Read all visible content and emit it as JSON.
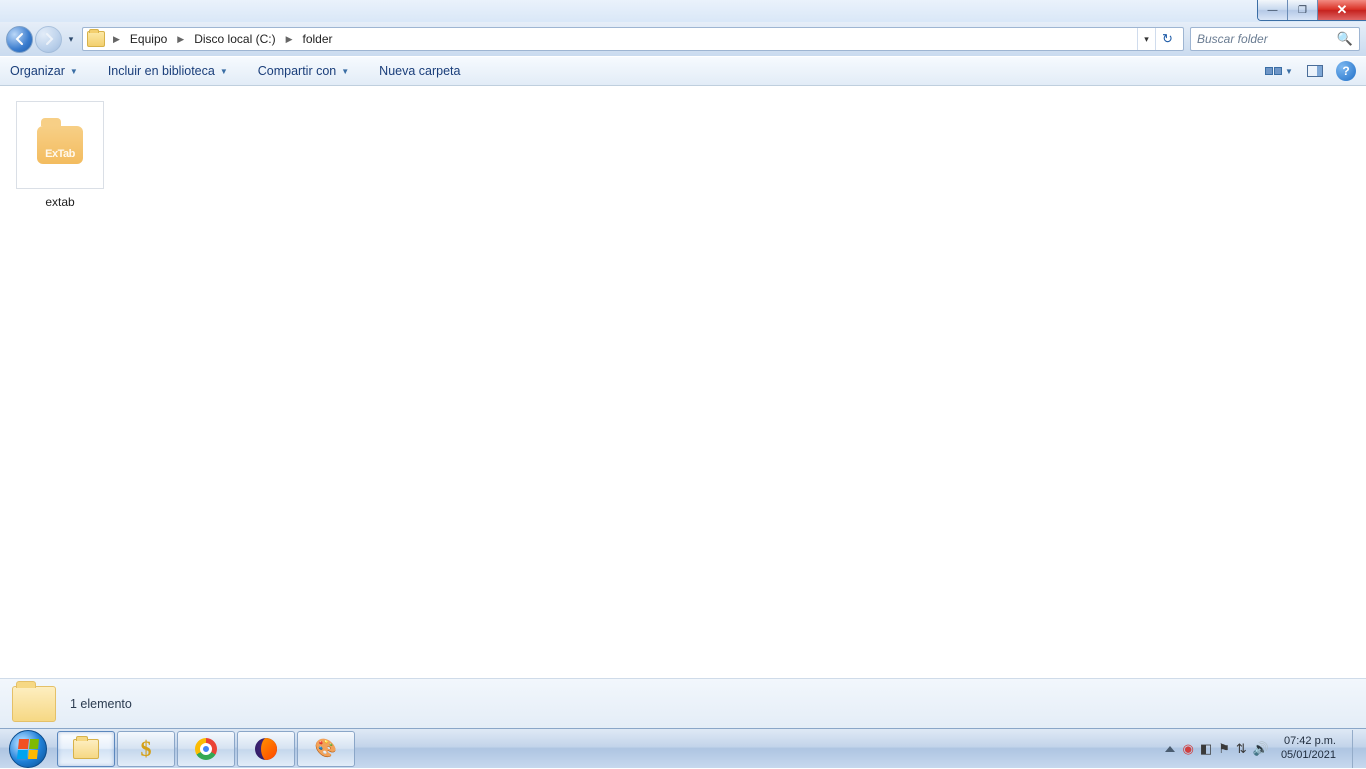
{
  "window_controls": {
    "min": "—",
    "max": "❐",
    "close": "✕"
  },
  "breadcrumb": {
    "items": [
      "Equipo",
      "Disco local (C:)",
      "folder"
    ],
    "sep": "▶"
  },
  "search": {
    "placeholder": "Buscar folder"
  },
  "toolbar": {
    "organize": "Organizar",
    "include": "Incluir en biblioteca",
    "share": "Compartir con",
    "newfolder": "Nueva carpeta"
  },
  "files": [
    {
      "name": "extab",
      "icon_text": "ExTab"
    }
  ],
  "details": {
    "summary": "1 elemento"
  },
  "tray": {
    "time": "07:42 p.m.",
    "date": "05/01/2021"
  }
}
